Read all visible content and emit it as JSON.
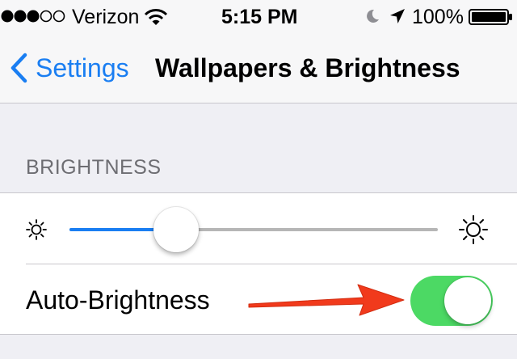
{
  "status_bar": {
    "carrier": "Verizon",
    "signal_bars_filled": 3,
    "signal_bars_total": 5,
    "time": "5:15 PM",
    "battery": "100%",
    "icons": [
      "wifi-icon",
      "moon-icon",
      "location-arrow-icon",
      "battery-icon"
    ]
  },
  "nav": {
    "back_label": "Settings",
    "title": "Wallpapers & Brightness"
  },
  "brightness": {
    "section_title": "BRIGHTNESS",
    "slider_level": 0.29,
    "icons": [
      "sun-small-icon",
      "sun-large-icon"
    ]
  },
  "auto_brightness": {
    "label": "Auto-Brightness",
    "on": true
  },
  "annotation": {
    "icon": "red-arrow-icon"
  },
  "colors": {
    "accent": "#1a7ef2",
    "toggle_on": "#4cd964",
    "annotation_arrow": "#f13a1c",
    "background": "#efeff4",
    "separator": "#c8c7cc"
  }
}
